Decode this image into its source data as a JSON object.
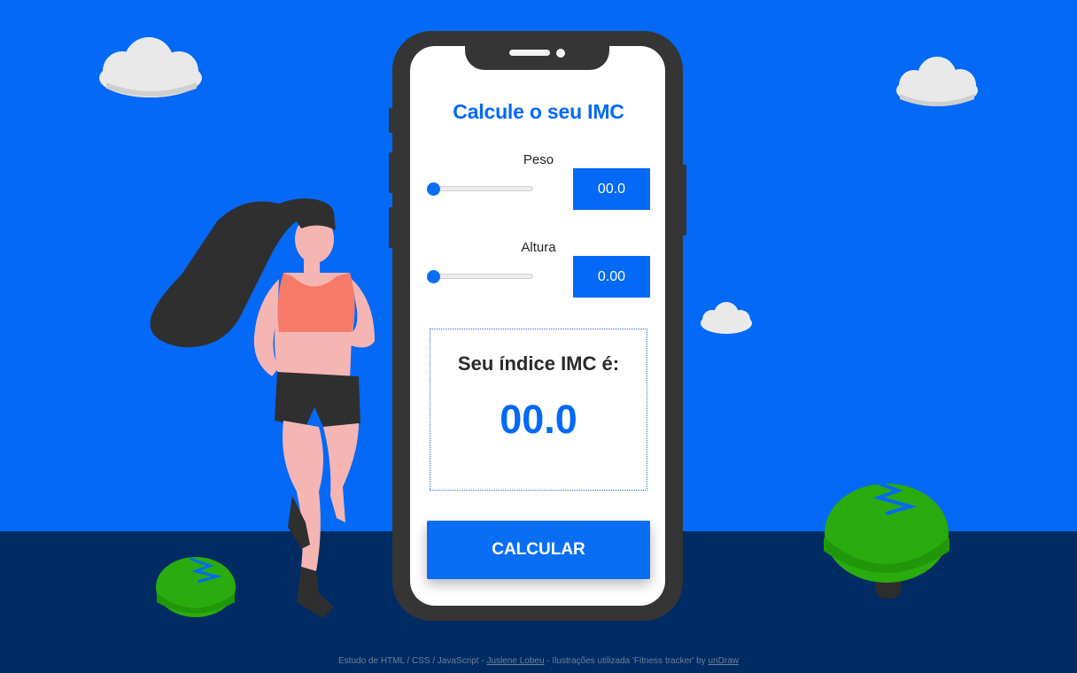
{
  "form": {
    "title": "Calcule o seu IMC",
    "weight_label": "Peso",
    "weight_value": "00.0",
    "weight_slider_level": 0,
    "height_label": "Altura",
    "height_value": "0.00",
    "height_slider_level": 0,
    "result_label": "Seu índice IMC é:",
    "result_value": "00.0",
    "calculate_label": "CALCULAR"
  },
  "footer": {
    "prefix": "Estudo de HTML / CSS / JavaScript - ",
    "author": "Juslene Lobeu",
    "middle": " - Ilustrações utilizada 'Fitness tracker' by ",
    "source": "unDraw"
  },
  "colors": {
    "sky": "#0469f6",
    "ground": "#002b63",
    "accent": "#0469f6",
    "phone_body": "#353535",
    "bush": "#25a80a"
  },
  "icons": [
    "cloud-illustration",
    "bush-illustration",
    "runner-illustration",
    "phone-illustration"
  ]
}
